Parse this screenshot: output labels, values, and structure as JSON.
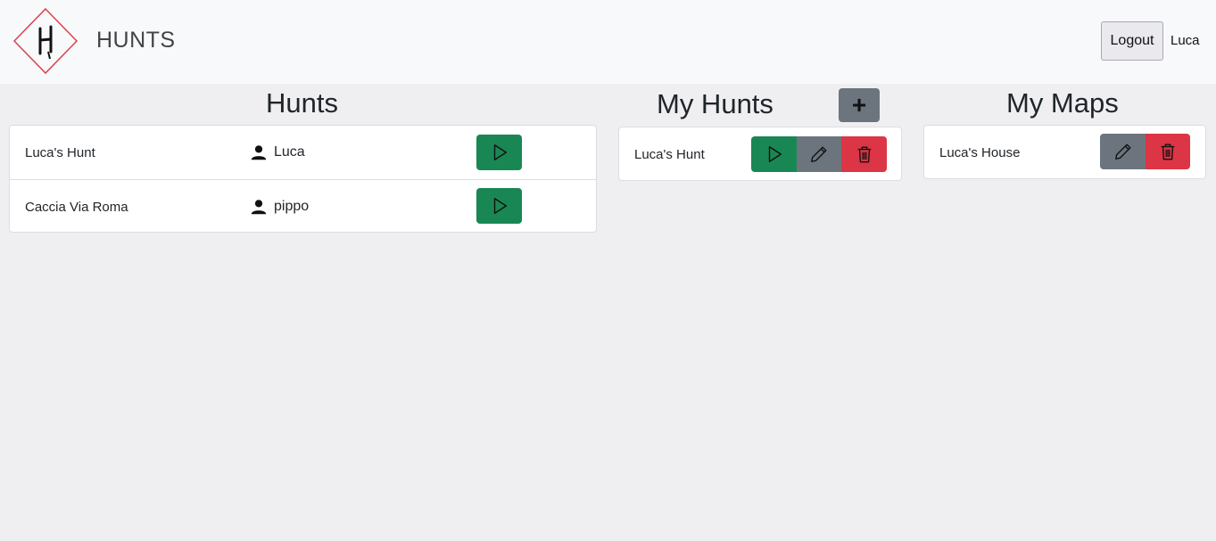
{
  "brand": {
    "name": "HUNTS",
    "logo_letter": "H"
  },
  "nav": {
    "logout_label": "Logout",
    "username": "Luca"
  },
  "hunts": {
    "title": "Hunts",
    "items": [
      {
        "name": "Luca's Hunt",
        "author": "Luca"
      },
      {
        "name": "Caccia Via Roma",
        "author": "pippo"
      }
    ]
  },
  "my_hunts": {
    "title": "My Hunts",
    "add_label": "+",
    "items": [
      {
        "name": "Luca's Hunt"
      }
    ]
  },
  "my_maps": {
    "title": "My Maps",
    "items": [
      {
        "name": "Luca's House"
      }
    ]
  },
  "colors": {
    "play": "#198754",
    "edit": "#6c757d",
    "delete": "#dc3545",
    "background": "#efeff1",
    "navbar": "#f8f9fa"
  },
  "icons": {
    "play": "play-icon",
    "edit": "pencil-icon",
    "delete": "trash-icon",
    "user": "person-icon"
  }
}
